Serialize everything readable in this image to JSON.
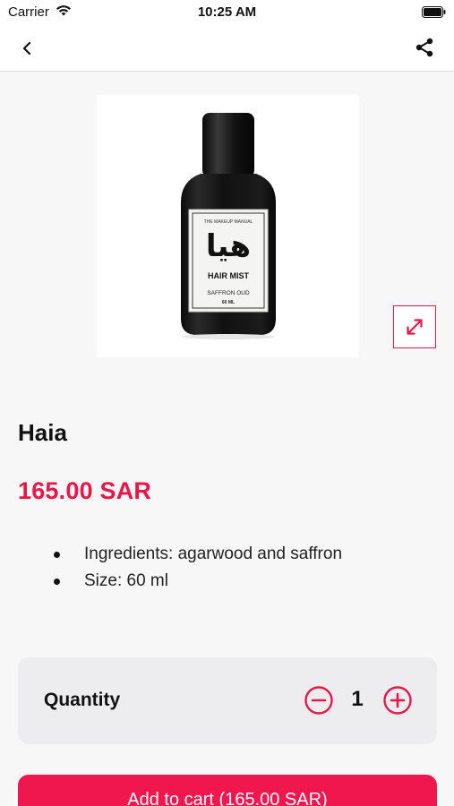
{
  "status_bar": {
    "carrier": "Carrier",
    "time": "10:25 AM"
  },
  "nav": {
    "back_icon": "chevron-left-icon",
    "share_icon": "share-icon"
  },
  "product_image": {
    "label_brand": "THE MAKEUP MANUAL",
    "label_arabic": "هيا",
    "label_type": "HAIR MIST",
    "label_scent": "SAFFRON OUD",
    "label_size": "60 ML",
    "expand_icon": "expand-arrows-icon"
  },
  "product": {
    "name": "Haia",
    "price": "165.00 SAR",
    "details": [
      "Ingredients: agarwood and saffron",
      "Size: 60 ml"
    ]
  },
  "quantity": {
    "label": "Quantity",
    "value": "1",
    "minus_icon": "minus-circle-icon",
    "plus_icon": "plus-circle-icon"
  },
  "cart": {
    "button_label": "Add to cart (165.00 SAR)"
  },
  "colors": {
    "accent": "#e8174a",
    "button": "#f0174e",
    "background": "#f7f7f8",
    "card": "#ededf0"
  }
}
